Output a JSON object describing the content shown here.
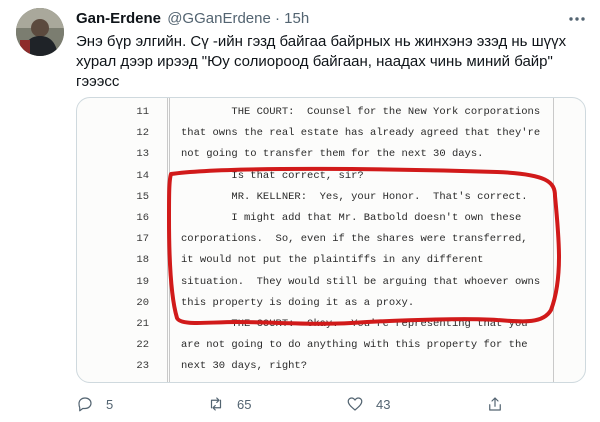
{
  "tweet": {
    "author_name": "Gan-Erdene",
    "author_handle": "@GGanErdene",
    "separator": "·",
    "timestamp": "15h",
    "text": "Энэ бүр элгийн. Сү -ийн гэзд байгаа байрных нь жинхэнэ эзэд нь шүүх хурал дээр ирээд \"Юу солиороод байгаан, наадах чинь миний байр\" гэээсс",
    "icons": {
      "avatar": "avatar-photo",
      "more": "more-icon",
      "reply": "reply-icon",
      "retweet": "retweet-icon",
      "like": "heart-icon",
      "share": "share-icon"
    },
    "stats": {
      "replies": "5",
      "retweets": "65",
      "likes": "43"
    }
  },
  "transcript": {
    "lines": [
      {
        "num": "11",
        "text": "        THE COURT:  Counsel for the New York corporations"
      },
      {
        "num": "12",
        "text": "that owns the real estate has already agreed that they're"
      },
      {
        "num": "13",
        "text": "not going to transfer them for the next 30 days."
      },
      {
        "num": "14",
        "text": "        Is that correct, sir?"
      },
      {
        "num": "15",
        "text": "        MR. KELLNER:  Yes, your Honor.  That's correct."
      },
      {
        "num": "16",
        "text": "        I might add that Mr. Batbold doesn't own these"
      },
      {
        "num": "17",
        "text": "corporations.  So, even if the shares were transferred,"
      },
      {
        "num": "18",
        "text": "it would not put the plaintiffs in any different"
      },
      {
        "num": "19",
        "text": "situation.  They would still be arguing that whoever owns"
      },
      {
        "num": "20",
        "text": "this property is doing it as a proxy."
      },
      {
        "num": "21",
        "text": "        THE COURT:  Okay.  You're representing that you"
      },
      {
        "num": "22",
        "text": "are not going to do anything with this property for the"
      },
      {
        "num": "23",
        "text": "next 30 days, right?"
      }
    ],
    "annotation_color": "#d11a1a"
  },
  "colors": {
    "text": "#0f1419",
    "muted": "#536471",
    "border": "#cfd9de"
  }
}
